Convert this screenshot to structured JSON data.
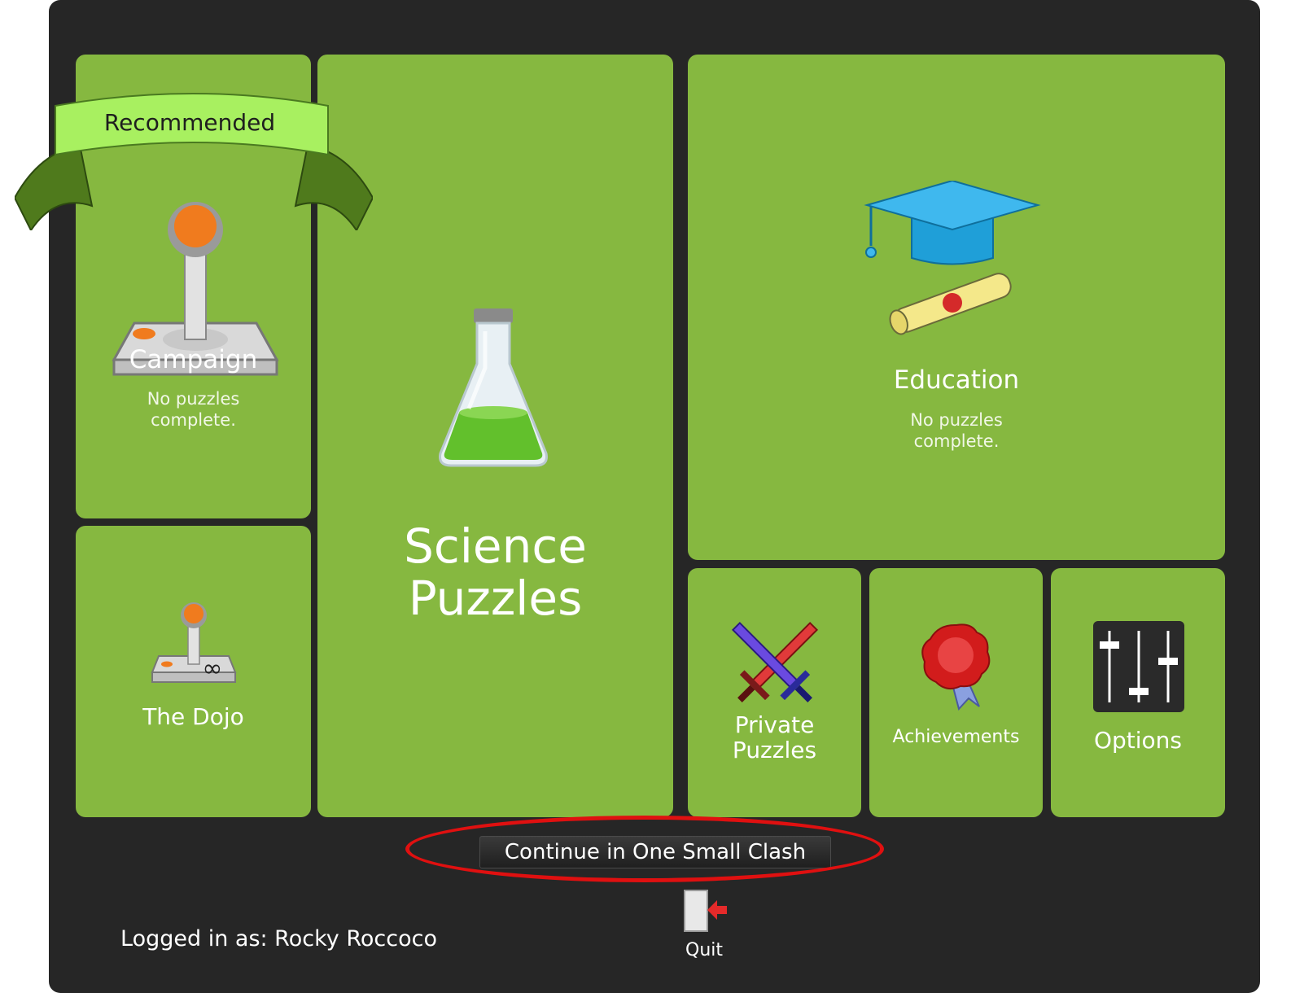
{
  "tiles": {
    "campaign": {
      "title": "Campaign",
      "subtitle_line1": "No puzzles",
      "subtitle_line2": "complete.",
      "badge": "Recommended",
      "icon": "joystick-icon"
    },
    "science": {
      "title_line1": "Science",
      "title_line2": "Puzzles",
      "icon": "flask-icon"
    },
    "education": {
      "title": "Education",
      "subtitle_line1": "No puzzles",
      "subtitle_line2": "complete.",
      "icon": "graduation-cap-icon"
    },
    "dojo": {
      "title": "The Dojo",
      "icon": "infinity-joystick-icon"
    },
    "private": {
      "title_line1": "Private",
      "title_line2": "Puzzles",
      "icon": "crossed-swords-icon"
    },
    "achievements": {
      "title": "Achievements",
      "icon": "wax-seal-icon"
    },
    "options": {
      "title": "Options",
      "icon": "sliders-icon"
    }
  },
  "continue_button": {
    "label": "Continue in One Small Clash"
  },
  "quit": {
    "label": "Quit",
    "icon": "exit-door-icon"
  },
  "login": {
    "text": "Logged in as: Rocky Roccoco"
  },
  "colors": {
    "tile": "#86b840",
    "panel": "#262626",
    "highlight": "#e01010",
    "ribbon": "#a8f060"
  }
}
